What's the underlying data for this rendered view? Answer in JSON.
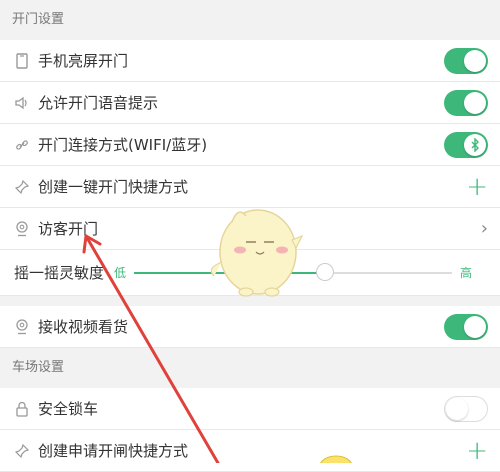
{
  "sections": {
    "door": "开门设置",
    "parking": "车场设置"
  },
  "rows": {
    "screen_unlock": "手机亮屏开门",
    "voice_prompt": "允许开门语音提示",
    "connection_mode": "开门连接方式(WIFI/蓝牙)",
    "shortcut": "创建一键开门快捷方式",
    "visitor": "访客开门",
    "shake": "摇一摇灵敏度",
    "video_goods": "接收视频看货",
    "safe_lock": "安全锁车",
    "gate_shortcut": "创建申请开闸快捷方式"
  },
  "slider": {
    "low_label": "低",
    "high_label": "高",
    "level": 0.6
  },
  "toggles": {
    "screen_unlock": true,
    "voice_prompt": true,
    "connection_mode": "bluetooth",
    "video_goods": true,
    "safe_lock": false
  },
  "colors": {
    "accent": "#3db87a",
    "annotation_arrow": "#e0413a"
  },
  "icons": {
    "screen_unlock": "phone-icon",
    "voice_prompt": "speaker-icon",
    "connection_mode": "link-icon",
    "shortcut": "pin-icon",
    "visitor": "camera-icon",
    "video_goods": "camera-icon",
    "safe_lock": "lock-icon",
    "gate_shortcut": "pin-icon"
  }
}
